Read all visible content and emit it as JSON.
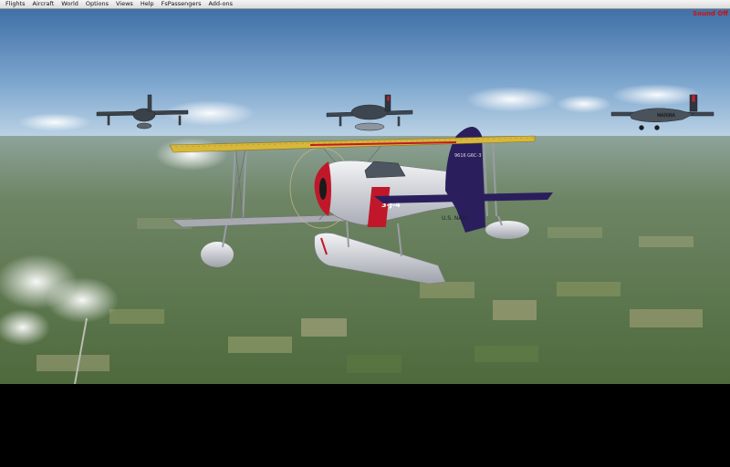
{
  "menu": {
    "items": [
      "Flights",
      "Aircraft",
      "World",
      "Options",
      "Views",
      "Help",
      "FsPassengers",
      "Add-ons"
    ]
  },
  "status": {
    "sound": "Sound Off",
    "sound_color": "#cc1111"
  },
  "scene": {
    "main_aircraft": {
      "markings": {
        "fuselage": "U.S. NAVY",
        "tail_left": "9616",
        "tail_right": "G6C-3",
        "nose_code": "3-J-4"
      },
      "colors": {
        "upper_wing": "#d8b83a",
        "tail": "#2a1f5c",
        "fuselage": "#e2e4e8",
        "nose_band": "#c0182a"
      }
    },
    "escort_right": {
      "marking": "MARINA"
    }
  }
}
